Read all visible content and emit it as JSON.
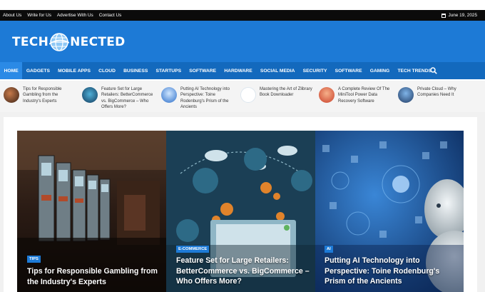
{
  "topbar": {
    "links": [
      "About Us",
      "Write for Us",
      "Advertise With Us",
      "Contact Us"
    ],
    "date": "June 19, 2025"
  },
  "brand": {
    "left": "TECH",
    "right": "NECTED"
  },
  "nav": {
    "items": [
      "HOME",
      "GADGETS",
      "MOBILE APPS",
      "CLOUD",
      "BUSINESS",
      "STARTUPS",
      "SOFTWARE",
      "HARDWARE",
      "SOCIAL MEDIA",
      "SECURITY",
      "SOFTWARE",
      "GAMING",
      "TECH TRENDS"
    ],
    "active": "HOME",
    "search_icon": "search-icon"
  },
  "ticker": [
    {
      "lines": [
        "Tips for Responsible",
        "Gambling from the",
        "Industry's Experts"
      ],
      "thumb_color": "#5a3a2a"
    },
    {
      "lines": [
        "Feature Set for Large",
        "Retailers: BetterCommerce",
        "vs. BigCommerce – Who",
        "Offers More?"
      ],
      "thumb_color": "#1c5a8a"
    },
    {
      "lines": [
        "Putting AI Technology into",
        "Perspective: Toine",
        "Rodenburg's Prism of the",
        "Ancients"
      ],
      "thumb_color": "#2d6fc9"
    },
    {
      "lines": [
        "Mastering the Art of Zlibrary",
        "Book Downloader"
      ],
      "thumb_color": "#e8eef3"
    },
    {
      "lines": [
        "A Complete Review Of The",
        "MiniTool Power Data",
        "Recovery Software"
      ],
      "thumb_color": "#d9553a"
    },
    {
      "lines": [
        "Private Cloud – Why",
        "Companies Need It"
      ],
      "thumb_color": "#2a4b7c"
    }
  ],
  "cards": [
    {
      "badge": "TIPS",
      "title_lines": [
        "Tips for Responsible Gambling from",
        "the Industry's Experts"
      ]
    },
    {
      "badge": "E-COMMERCE",
      "title_lines": [
        "Feature Set for Large Retailers:",
        "BetterCommerce vs. BigCommerce –",
        "Who Offers More?"
      ]
    },
    {
      "badge": "AI",
      "title_lines": [
        "Putting AI Technology into",
        "Perspective: Toine Rodenburg's",
        "Prism of the Ancients"
      ]
    }
  ],
  "colors": {
    "topbar": "#0b0b0b",
    "header": "#1d7ad6",
    "nav": "#1369bd",
    "nav_active": "#2b8ae6",
    "badge": "#1d7ad6"
  }
}
